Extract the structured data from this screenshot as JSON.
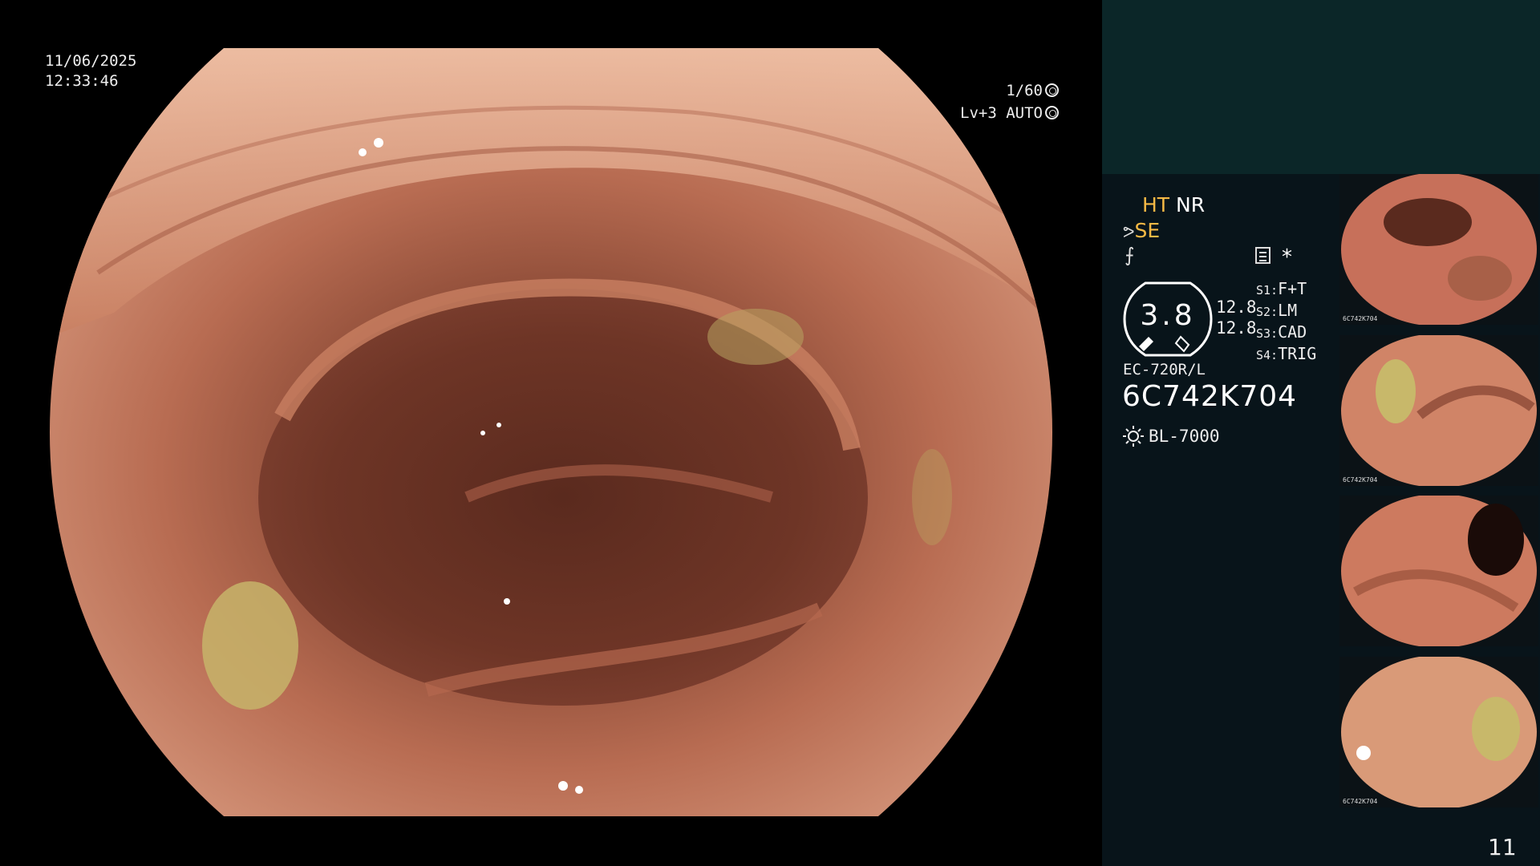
{
  "datetime": {
    "date": "11/06/2025",
    "time": "12:33:46"
  },
  "video_info": {
    "shutter": "1/60",
    "level": "Lv+3",
    "mode": "AUTO"
  },
  "processor": {
    "mode_primary": "HT",
    "mode_secondary": "NR",
    "se_label": "SE",
    "filter_symbol": "⨍",
    "asterisk": "*",
    "gauge_value": "3.8",
    "gauge_right_top": "12.8",
    "gauge_right_bottom": "12.8",
    "switches": [
      {
        "key": "S1:",
        "value": "F+T"
      },
      {
        "key": "S2:",
        "value": "LM"
      },
      {
        "key": "S3:",
        "value": "CAD"
      },
      {
        "key": "S4:",
        "value": "TRIG"
      }
    ],
    "scope_model": "EC-720R/L",
    "scope_serial": "6C742K704",
    "light_source": "BL-7000"
  },
  "thumbnails": [
    {
      "caption": "6C742K704",
      "tone": "#c7705a"
    },
    {
      "caption": "6C742K704",
      "tone": "#d08467"
    },
    {
      "caption": "",
      "tone": "#cd7a5f"
    },
    {
      "caption": "6C742K704",
      "tone": "#d99a78"
    }
  ],
  "page_number": "11",
  "colors": {
    "panel_top": "#0b2628",
    "panel": "#08141a",
    "accent_amber": "#f5b945",
    "mucosa": "#c98062"
  }
}
